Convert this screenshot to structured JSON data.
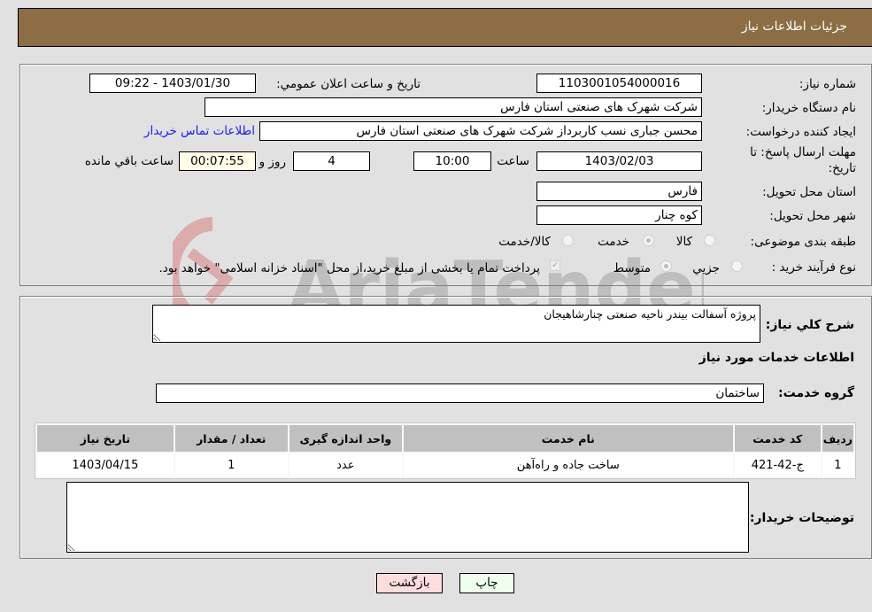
{
  "header": {
    "title": "جزئیات اطلاعات نیاز"
  },
  "details": {
    "need_number_label": "شماره نیاز:",
    "need_number": "1103001054000016",
    "announce_label": "تاریخ و ساعت اعلان عمومي:",
    "announce_value": "1403/01/30 - 09:22",
    "buyer_org_label": "نام دستگاه خریدار:",
    "buyer_org": "شرکت شهرک های صنعتی استان فارس",
    "creator_label": "ایجاد کننده درخواست:",
    "creator": "محسن  جباری نسب کاربرداز شرکت شهرک های صنعتی استان فارس",
    "contact_link": "اطلاعات تماس خریدار",
    "deadline_label_1": "مهلت ارسال پاسخ: تا",
    "deadline_label_2": "تاریخ:",
    "deadline_date": "1403/02/03",
    "hour_label": "ساعت",
    "deadline_time": "10:00",
    "days_value": "4",
    "days_label": "روز و",
    "remaining_time": "00:07:55",
    "remaining_label": "ساعت باقي مانده",
    "province_label": "استان محل تحویل:",
    "province": "فارس",
    "city_label": "شهر محل تحویل:",
    "city": "کوه چنار",
    "category_label": "طبقه بندی موضوعی:",
    "category_options": [
      "کالا",
      "خدمت",
      "کالا/خدمت"
    ],
    "category_selected": "خدمت",
    "process_label": "نوع فرآیند خرید :",
    "process_options": [
      "جزيي",
      "متوسط"
    ],
    "process_selected": "متوسط",
    "treasury_note": "پرداخت تمام یا بخشی از مبلغ خرید،از محل \"اسناد خزانه اسلامی\" خواهد بود.",
    "treasury_checked": true
  },
  "services": {
    "description_label": "شرح کلي نياز:",
    "description": "پروژه آسفالت بیندر ناحیه صنعتی چنارشاهیجان",
    "section_title": "اطلاعات خدمات مورد نياز",
    "group_label": "گروه خدمت:",
    "group_value": "ساختمان",
    "table": {
      "headers": [
        "ردیف",
        "کد خدمت",
        "نام خدمت",
        "واحد اندازه گیری",
        "تعداد / مقدار",
        "تاریخ نیاز"
      ],
      "rows": [
        [
          "1",
          "ج-42-421",
          "ساخت جاده و راه‌آهن",
          "عدد",
          "1",
          "1403/04/15"
        ]
      ]
    },
    "buyer_notes_label": "توضیحات خریدار:",
    "buyer_notes": ""
  },
  "buttons": {
    "print": "چاپ",
    "back": "بازگشت"
  },
  "watermark": {
    "text": "AriaTender.neT"
  }
}
